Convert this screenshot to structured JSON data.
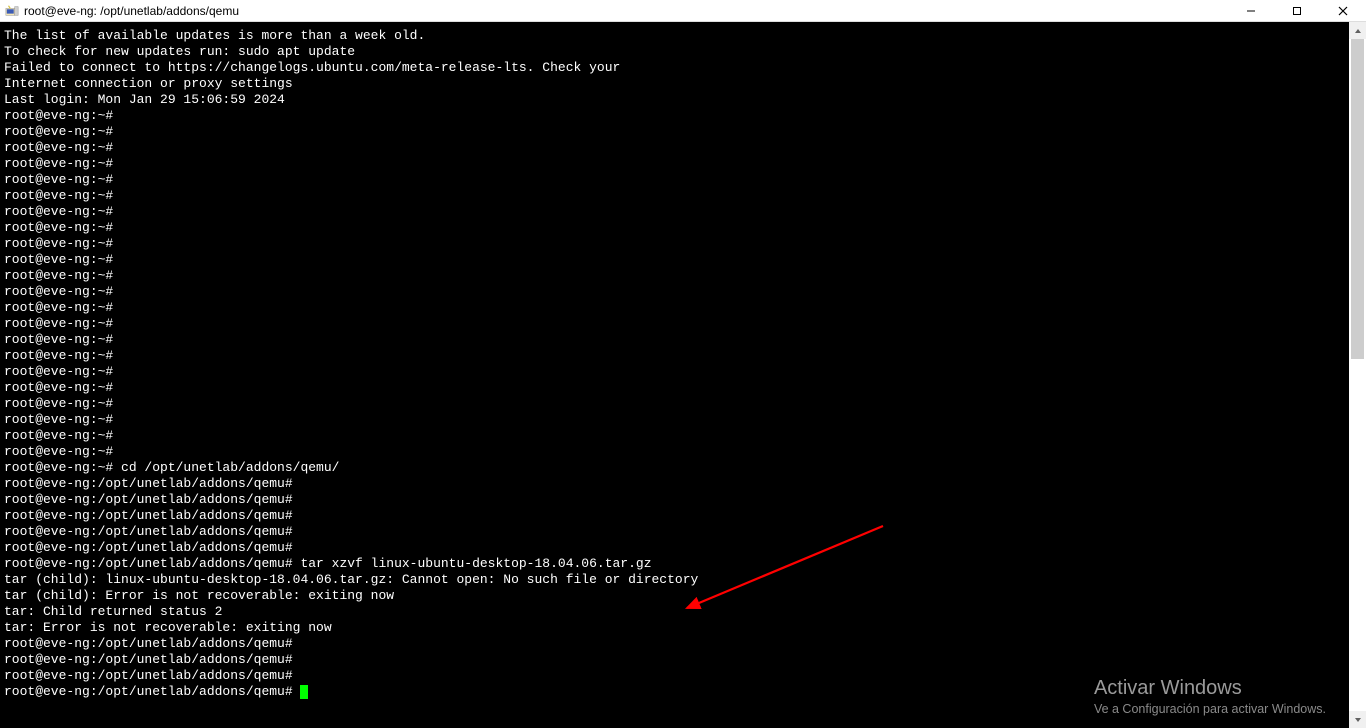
{
  "window": {
    "title": "root@eve-ng: /opt/unetlab/addons/qemu"
  },
  "terminal": {
    "lines": [
      "The list of available updates is more than a week old.",
      "To check for new updates run: sudo apt update",
      "Failed to connect to https://changelogs.ubuntu.com/meta-release-lts. Check your",
      "Internet connection or proxy settings",
      "",
      "",
      "Last login: Mon Jan 29 15:06:59 2024",
      "root@eve-ng:~#",
      "root@eve-ng:~#",
      "root@eve-ng:~#",
      "root@eve-ng:~#",
      "root@eve-ng:~#",
      "root@eve-ng:~#",
      "root@eve-ng:~#",
      "root@eve-ng:~#",
      "root@eve-ng:~#",
      "root@eve-ng:~#",
      "root@eve-ng:~#",
      "root@eve-ng:~#",
      "root@eve-ng:~#",
      "root@eve-ng:~#",
      "root@eve-ng:~#",
      "root@eve-ng:~#",
      "root@eve-ng:~#",
      "root@eve-ng:~#",
      "root@eve-ng:~#",
      "root@eve-ng:~#",
      "root@eve-ng:~#",
      "root@eve-ng:~#",
      "root@eve-ng:~# cd /opt/unetlab/addons/qemu/",
      "root@eve-ng:/opt/unetlab/addons/qemu#",
      "root@eve-ng:/opt/unetlab/addons/qemu#",
      "root@eve-ng:/opt/unetlab/addons/qemu#",
      "root@eve-ng:/opt/unetlab/addons/qemu#",
      "root@eve-ng:/opt/unetlab/addons/qemu#",
      "root@eve-ng:/opt/unetlab/addons/qemu# tar xzvf linux-ubuntu-desktop-18.04.06.tar.gz",
      "tar (child): linux-ubuntu-desktop-18.04.06.tar.gz: Cannot open: No such file or directory",
      "tar (child): Error is not recoverable: exiting now",
      "tar: Child returned status 2",
      "tar: Error is not recoverable: exiting now",
      "root@eve-ng:/opt/unetlab/addons/qemu#",
      "root@eve-ng:/opt/unetlab/addons/qemu#",
      "root@eve-ng:/opt/unetlab/addons/qemu#",
      "root@eve-ng:/opt/unetlab/addons/qemu# "
    ]
  },
  "watermark": {
    "title": "Activar Windows",
    "subtitle": "Ve a Configuración para activar Windows."
  },
  "annotation": {
    "arrow_color": "#ff0000"
  }
}
